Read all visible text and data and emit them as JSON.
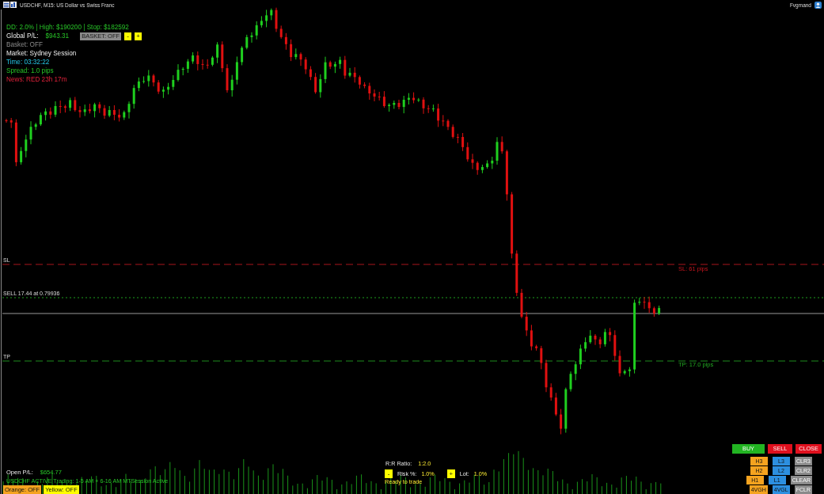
{
  "window": {
    "title": "USDCHF, M15: US Dollar vs Swiss Franc",
    "account": "Fvgmand"
  },
  "info_panel": {
    "summary": "DD: 2.0% | High: $190200 | Stop: $182592",
    "global_pl": {
      "label": "Global P/L:",
      "value": "$943.31"
    },
    "basket_toggle": {
      "label": "BASKET: OFF",
      "on": false
    },
    "basket_buttons": [
      "-",
      "+"
    ],
    "lines": [
      {
        "text": "Basket: OFF",
        "kind": "muted"
      },
      {
        "text": "Market: Sydney Session",
        "kind": "plain"
      },
      {
        "text": "Time: 03:32:22",
        "kind": "time"
      },
      {
        "text": "Spread: 1.0 pips",
        "kind": "good"
      },
      {
        "text": "News: RED 23h 17m",
        "kind": "alert"
      }
    ]
  },
  "price_lines": [
    {
      "kind": "stop_loss",
      "label": "SL",
      "tag": "SL: 61 pips"
    },
    {
      "kind": "entry",
      "label": "SELL 17.44 at 0.79936"
    },
    {
      "kind": "take_profit",
      "label": "TP",
      "tag": "TP: 17.0 pips"
    }
  ],
  "open_pl": {
    "label": "Open P/L:",
    "value": "$654.77"
  },
  "session_status": "USDCHF ACTIVE Trading: 1-5 AM + 6-16 AM MTSession Active",
  "toggles": [
    {
      "label": "Orange: OFF",
      "color": "#f5a31f"
    },
    {
      "label": "Yellow: OFF",
      "color": "#ffff00"
    }
  ],
  "risk_panel": {
    "ratio_label": "R:R Ratio:",
    "ratio_value": "1:2.0",
    "decrease": "-",
    "risk_label": "Risk %:",
    "risk_value": "1.0%",
    "increase": "+",
    "lot_label": "Lot:",
    "lot_value": "1.0%",
    "status": "Ready to trade"
  },
  "trade_buttons": [
    {
      "label": "BUY",
      "kind": "buy"
    },
    {
      "label": "SELL",
      "kind": "sell"
    },
    {
      "label": "CLOSE",
      "kind": "close"
    }
  ],
  "level_rows": [
    [
      {
        "label": "H3",
        "kind": "high"
      },
      {
        "label": "L3",
        "kind": "low"
      },
      {
        "label": "CLR3",
        "kind": "clear"
      }
    ],
    [
      {
        "label": "H2",
        "kind": "high"
      },
      {
        "label": "L2",
        "kind": "low"
      },
      {
        "label": "CLR2",
        "kind": "clear"
      }
    ],
    [
      {
        "label": "H1",
        "kind": "high"
      },
      {
        "label": "L1",
        "kind": "low"
      },
      {
        "label": "CLEAR",
        "kind": "clear"
      }
    ],
    [
      {
        "label": "4VGH",
        "kind": "high"
      },
      {
        "label": "4VGL",
        "kind": "low"
      },
      {
        "label": "FCLR",
        "kind": "clear"
      }
    ]
  ]
}
